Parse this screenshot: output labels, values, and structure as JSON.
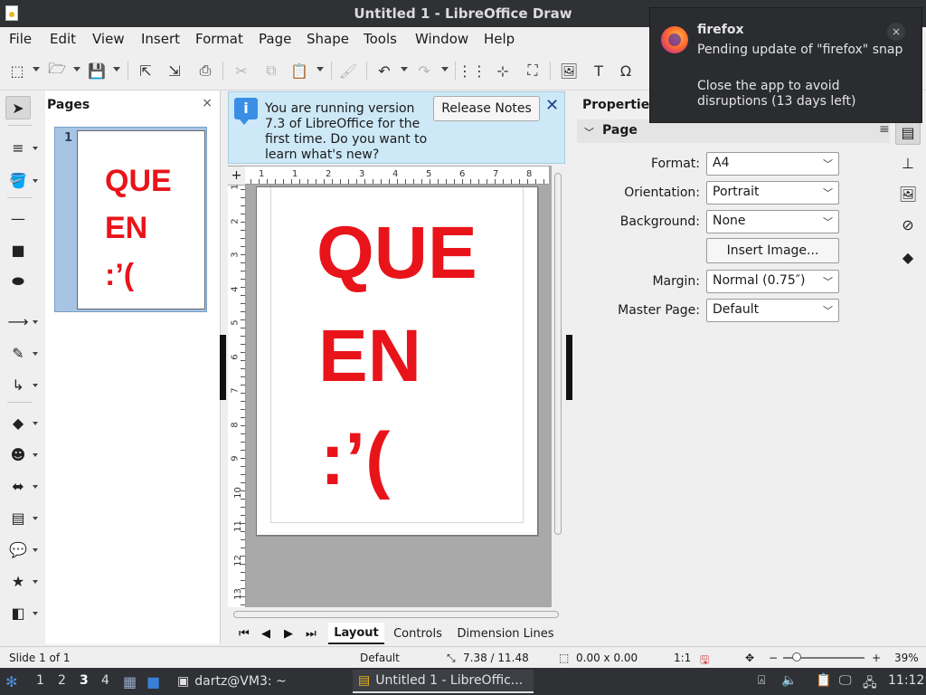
{
  "window": {
    "title": "Untitled 1 - LibreOffice Draw"
  },
  "menu": [
    "File",
    "Edit",
    "View",
    "Insert",
    "Format",
    "Page",
    "Shape",
    "Tools",
    "Window",
    "Help"
  ],
  "pages_pane": {
    "title": "Pages",
    "close": "×",
    "thumbnail": {
      "number": "1",
      "lines": [
        "QUE",
        "EN",
        ":’("
      ]
    }
  },
  "infobar": {
    "icon": "i",
    "message": "You are running version 7.3 of LibreOffice for the first time. Do you want to learn what's new?",
    "release_notes_label": "Release Notes",
    "close": "✕"
  },
  "document": {
    "lines": [
      "QUE",
      "EN",
      ":’("
    ]
  },
  "rulers": {
    "corner": "+",
    "h_numbers": [
      "1",
      "1",
      "2",
      "3",
      "4",
      "5",
      "6",
      "7",
      "8"
    ],
    "v_numbers": [
      "1",
      "2",
      "3",
      "4",
      "5",
      "6",
      "7",
      "8",
      "9",
      "10",
      "11",
      "12",
      "13"
    ]
  },
  "tabs": {
    "items": [
      "Layout",
      "Controls",
      "Dimension Lines"
    ],
    "active": "Layout",
    "nav": [
      "⏮",
      "◀",
      "▶",
      "⏭"
    ]
  },
  "properties": {
    "title": "Properties",
    "section": "Page",
    "menu_glyph": "≡",
    "format_label": "Format:",
    "format_value": "A4",
    "orientation_label": "Orientation:",
    "orientation_value": "Portrait",
    "background_label": "Background:",
    "background_value": "None",
    "insert_image_label": "Insert Image...",
    "margin_label": "Margin:",
    "margin_value": "Normal (0.75″)",
    "master_page_label": "Master Page:",
    "master_page_value": "Default"
  },
  "statusbar": {
    "slide": "Slide 1 of 1",
    "layout": "Default",
    "position": "7.38 / 11.48",
    "size": "0.00 x 0.00",
    "scale": "1:1",
    "zoom": "39%",
    "zoom_minus": "−",
    "zoom_plus": "+"
  },
  "taskbar": {
    "workspaces": [
      "1",
      "2",
      "3",
      "4"
    ],
    "active_workspace": "3",
    "terminal_task": "dartz@VM3: ~",
    "app_task": "Untitled 1 - LibreOffic...",
    "clock": "11:12"
  },
  "notification": {
    "title": "firefox",
    "body1": "Pending update of \"firefox\" snap",
    "body2": "Close the app to avoid disruptions (13 days left)",
    "close": "×"
  },
  "colors": {
    "accent_red": "#e8141a",
    "title_bg": "#2f3135",
    "infobar_bg": "#cde8f6"
  }
}
